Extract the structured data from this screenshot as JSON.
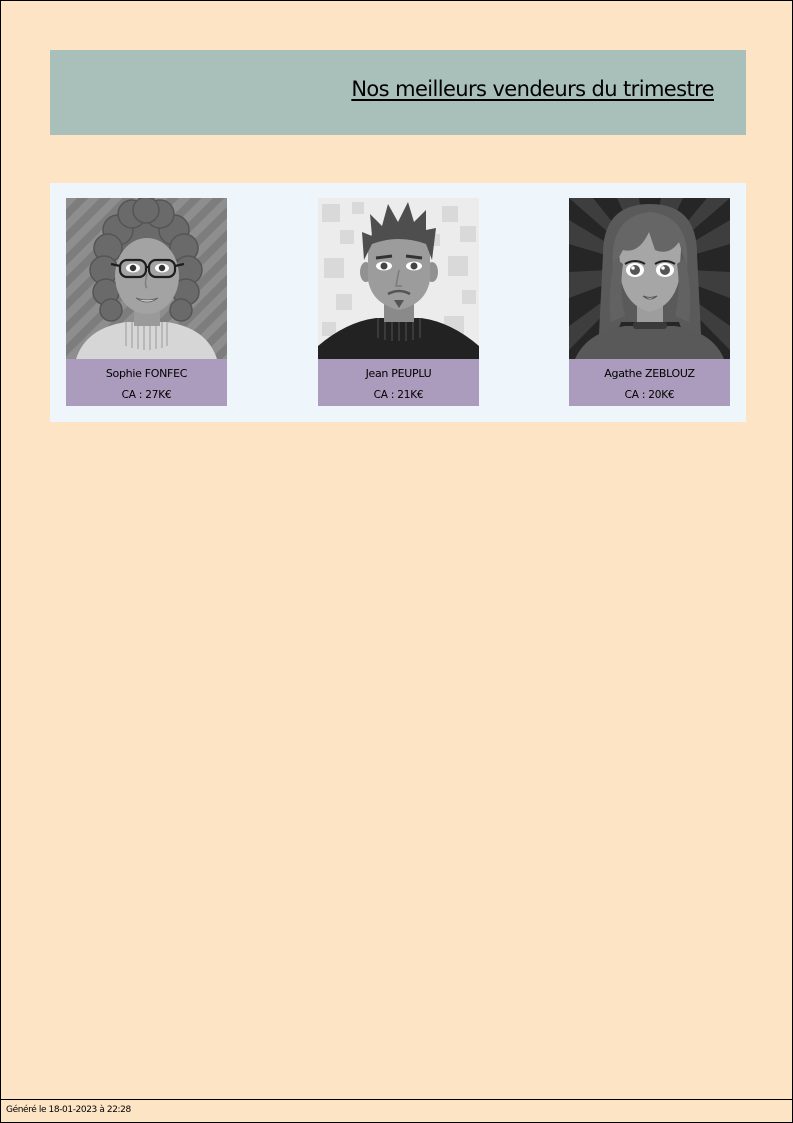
{
  "header": {
    "title": "Nos meilleurs vendeurs du trimestre"
  },
  "sellers": [
    {
      "name": "Sophie FONFEC",
      "ca": "CA : 27K€",
      "avatar": "woman-curly-hair-glasses-avatar"
    },
    {
      "name": "Jean PEUPLU",
      "ca": "CA : 21K€",
      "avatar": "man-spiky-hair-goatee-avatar"
    },
    {
      "name": "Agathe ZEBLOUZ",
      "ca": "CA : 20K€",
      "avatar": "woman-long-hair-anime-avatar"
    }
  ],
  "footer": {
    "generated": "Généré le 18-01-2023 à 22:28"
  },
  "colors": {
    "page_background": "#fde4c4",
    "header_background": "#a8bfba",
    "panel_background": "#eef6fc",
    "card_caption_background": "#ab9cbd"
  }
}
